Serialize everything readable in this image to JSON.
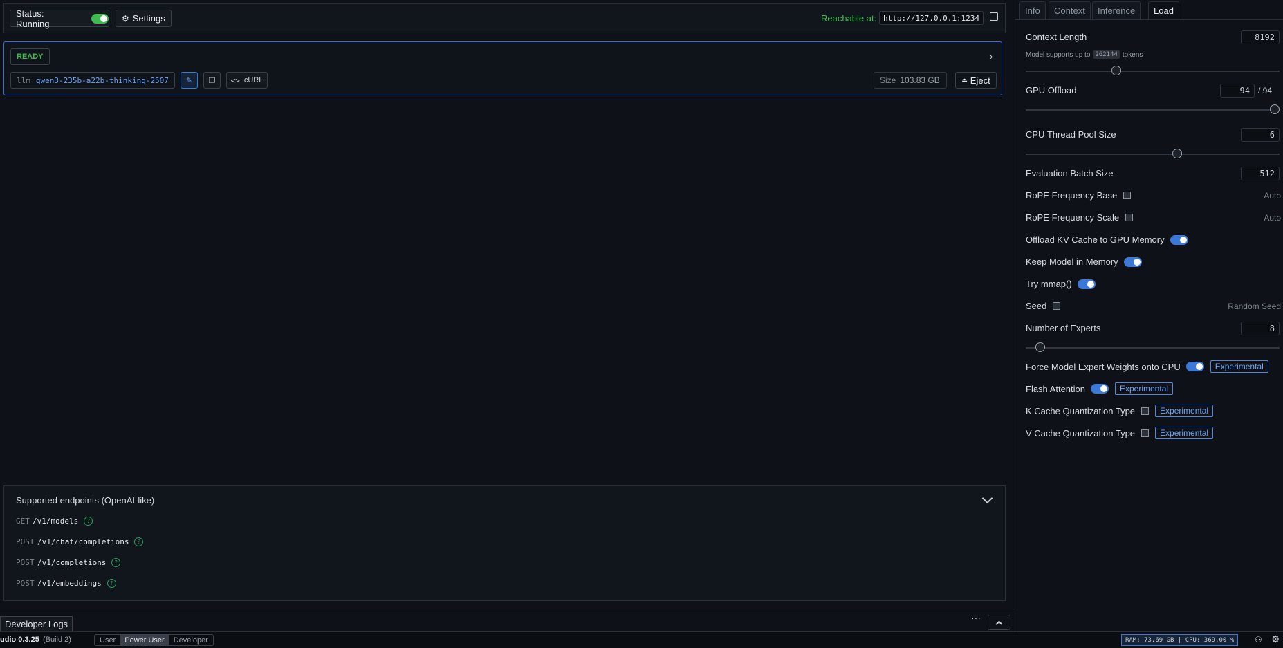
{
  "topbar": {
    "status_label": "Status: Running",
    "settings_label": "Settings",
    "reachable_label": "Reachable at:",
    "url": "http://127.0.0.1:1234"
  },
  "model": {
    "status": "READY",
    "type": "llm",
    "id": "qwen3-235b-a22b-thinking-2507",
    "curl_label": "cURL",
    "size_label": "Size",
    "size_value": "103.83 GB",
    "eject_label": "Eject"
  },
  "endpoints": {
    "title": "Supported endpoints (OpenAI-like)",
    "items": [
      {
        "method": "GET",
        "path": "/v1/models"
      },
      {
        "method": "POST",
        "path": "/v1/chat/completions"
      },
      {
        "method": "POST",
        "path": "/v1/completions"
      },
      {
        "method": "POST",
        "path": "/v1/embeddings"
      }
    ]
  },
  "devlogs": {
    "tab_label": "Developer Logs"
  },
  "statusbar": {
    "app_version": "udio 0.3.25",
    "build": "(Build 2)",
    "modes": [
      "User",
      "Power User",
      "Developer"
    ],
    "active_mode": "Power User",
    "resources": "RAM: 73.69 GB | CPU: 369.00 %"
  },
  "right_panel": {
    "tabs": [
      "Info",
      "Context",
      "Inference",
      "Load"
    ],
    "active_tab": "Load",
    "context_length": {
      "label": "Context Length",
      "value": "8192",
      "hint_prefix": "Model supports up to",
      "hint_max": "262144",
      "hint_suffix": "tokens",
      "slider_fraction": 0.35
    },
    "gpu_offload": {
      "label": "GPU Offload",
      "value": "94",
      "max": "/ 94",
      "slider_fraction": 1.0
    },
    "cpu_threads": {
      "label": "CPU Thread Pool Size",
      "value": "6",
      "slider_fraction": 0.6
    },
    "eval_batch": {
      "label": "Evaluation Batch Size",
      "value": "512"
    },
    "rope_base": {
      "label": "RoPE Frequency Base",
      "value": "Auto"
    },
    "rope_scale": {
      "label": "RoPE Frequency Scale",
      "value": "Auto"
    },
    "offload_kv": {
      "label": "Offload KV Cache to GPU Memory"
    },
    "keep_memory": {
      "label": "Keep Model in Memory"
    },
    "mmap": {
      "label": "Try mmap()"
    },
    "seed": {
      "label": "Seed",
      "value": "Random Seed"
    },
    "experts": {
      "label": "Number of Experts",
      "value": "8",
      "slider_fraction": 0.04
    },
    "force_expert": {
      "label": "Force Model Expert Weights onto CPU"
    },
    "flash_attention": {
      "label": "Flash Attention"
    },
    "k_cache": {
      "label": "K Cache Quantization Type"
    },
    "v_cache": {
      "label": "V Cache Quantization Type"
    },
    "experimental_label": "Experimental"
  },
  "colors": {
    "accent": "#3c78d8",
    "success": "#3fb950",
    "background": "#0d1117"
  }
}
